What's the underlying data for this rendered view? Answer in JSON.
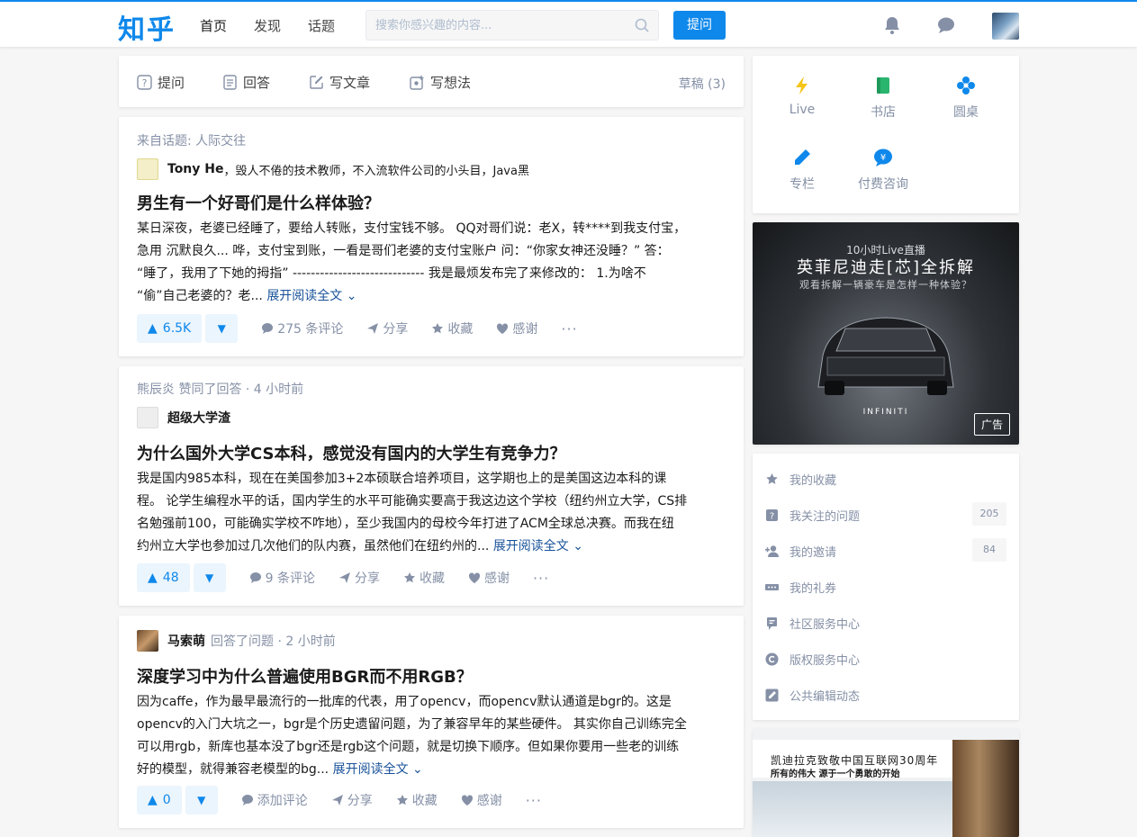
{
  "header": {
    "logo": "知乎",
    "nav": [
      "首页",
      "发现",
      "话题"
    ],
    "search_placeholder": "搜索你感兴趣的内容...",
    "ask_label": "提问"
  },
  "compose": {
    "items": [
      "提问",
      "回答",
      "写文章",
      "写想法"
    ],
    "drafts": "草稿 (3)"
  },
  "feed": [
    {
      "meta": "来自话题: 人际交往",
      "author": "Tony He",
      "bio": "，毁人不倦的技术教师，不入流软件公司的小头目，Java黑",
      "title": "男生有一个好哥们是什么样体验？",
      "lines": [
        "某日深夜，老婆已经睡了，要给人转账，支付宝钱不够。 QQ对哥们说：老X，转****到我支付宝，",
        "急用 沉默良久... 哗，支付宝到账，一看是哥们老婆的支付宝账户 问：“你家女神还没睡？” 答：",
        "“睡了，我用了下她的拇指” ----------------------------- 我是最烦发布完了来修改的： 1.为啥不",
        "“偷”自己老婆的？老..."
      ],
      "readmore": "展开阅读全文",
      "votes": "6.5K",
      "comments": "275 条评论"
    },
    {
      "meta": "熊辰炎 赞同了回答 · 4 小时前",
      "author": "超级大学渣",
      "bio": "",
      "title": "为什么国外大学CS本科，感觉没有国内的大学生有竞争力？",
      "lines": [
        "我是国内985本科，现在在美国参加3+2本硕联合培养项目，这学期也上的是美国这边本科的课",
        "程。 论学生编程水平的话，国内学生的水平可能确实要高于我这边这个学校（纽约州立大学，CS排",
        "名勉强前100，可能确实学校不咋地），至少我国内的母校今年打进了ACM全球总决赛。而我在纽",
        "约州立大学也参加过几次他们的队内赛，虽然他们在纽约州的..."
      ],
      "readmore": "展开阅读全文",
      "votes": "48",
      "comments": "9 条评论"
    },
    {
      "meta": "回答了问题 · 2 小时前",
      "author": "马索萌",
      "bio": "",
      "title": "深度学习中为什么普遍使用BGR而不用RGB？",
      "lines": [
        "因为caffe，作为最早最流行的一批库的代表，用了opencv，而opencv默认通道是bgr的。这是",
        "opencv的入门大坑之一，bgr是个历史遗留问题，为了兼容早年的某些硬件。 其实你自己训练完全",
        "可以用rgb，新库也基本没了bgr还是rgb这个问题，就是切换下顺序。但如果你要用一些老的训练",
        "好的模型，就得兼容老模型的bg..."
      ],
      "readmore": "展开阅读全文",
      "votes": "0",
      "comments": "添加评论"
    }
  ],
  "actions": {
    "share": "分享",
    "collect": "收藏",
    "thanks": "感谢",
    "more": "···"
  },
  "sidebar": {
    "quick": [
      "Live",
      "书店",
      "圆桌",
      "专栏",
      "付费咨询"
    ],
    "ad1": {
      "line1": "10小时Live直播",
      "line2": "英菲尼迪走[芯]全拆解",
      "line3": "观看拆解一辆豪车是怎样一种体验？",
      "brand": "INFINITI",
      "badge": "广告"
    },
    "links": [
      {
        "label": "我的收藏",
        "count": ""
      },
      {
        "label": "我关注的问题",
        "count": "205"
      },
      {
        "label": "我的邀请",
        "count": "84"
      },
      {
        "label": "我的礼券",
        "count": ""
      },
      {
        "label": "社区服务中心",
        "count": ""
      },
      {
        "label": "版权服务中心",
        "count": ""
      },
      {
        "label": "公共编辑动态",
        "count": ""
      }
    ],
    "ad2": {
      "line1": "凯迪拉克致敬中国互联网30周年",
      "line2": "所有的伟大 源于一个勇敢的开始"
    }
  },
  "colors": {
    "brand": "#0f88eb",
    "link": "#175199",
    "muted": "#8590a6",
    "bg": "#f6f6f6"
  }
}
